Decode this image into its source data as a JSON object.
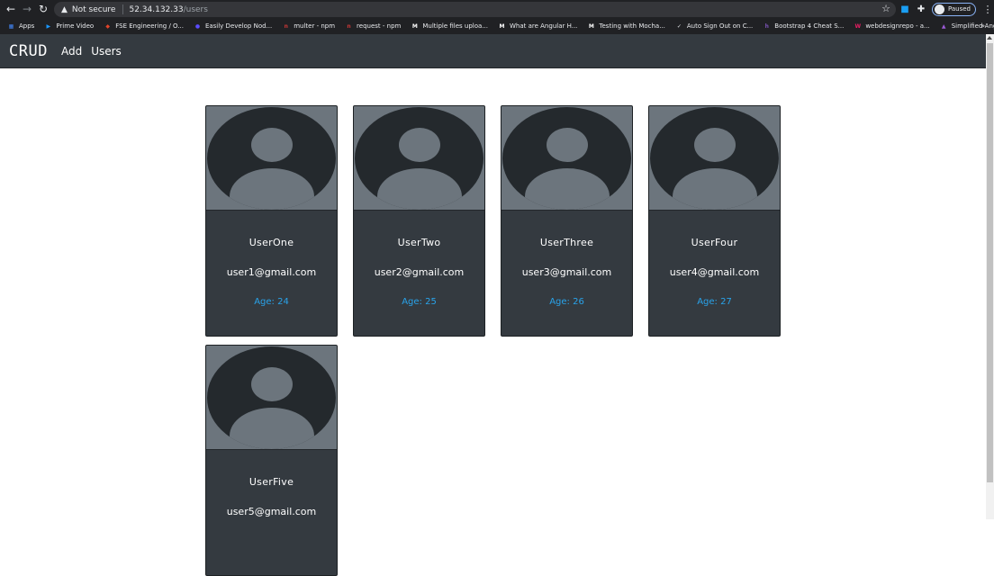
{
  "browser": {
    "security_label": "Not secure",
    "url_host": "52.34.132.33",
    "url_path": "/users",
    "profile_label": "Paused",
    "bookmarks": [
      {
        "label": "Apps",
        "color": "#4285f4",
        "glyph": "▦"
      },
      {
        "label": "Prime Video",
        "color": "#1a98ff",
        "glyph": "▶"
      },
      {
        "label": "FSE Engineering / O...",
        "color": "#e24329",
        "glyph": "◆"
      },
      {
        "label": "Easily Develop Nod...",
        "color": "#5b4cff",
        "glyph": "●"
      },
      {
        "label": "multer - npm",
        "color": "#cb3837",
        "glyph": "n"
      },
      {
        "label": "request - npm",
        "color": "#cb3837",
        "glyph": "n"
      },
      {
        "label": "Multiple files uploa...",
        "color": "#ffffff",
        "glyph": "M"
      },
      {
        "label": "What are Angular H...",
        "color": "#ffffff",
        "glyph": "M"
      },
      {
        "label": "Testing with Mocha...",
        "color": "#ffffff",
        "glyph": "M"
      },
      {
        "label": "Auto Sign Out on C...",
        "color": "#e8eaed",
        "glyph": "✓"
      },
      {
        "label": "Bootstrap 4 Cheat S...",
        "color": "#7952b3",
        "glyph": "h"
      },
      {
        "label": "webdesignrepo - a...",
        "color": "#e91e63",
        "glyph": "W"
      },
      {
        "label": "Simplified Angular...",
        "color": "#9c5bd6",
        "glyph": "▲"
      }
    ]
  },
  "navbar": {
    "brand": "CRUD",
    "links": [
      "Add",
      "Users"
    ]
  },
  "users": [
    {
      "name": "UserOne",
      "email": "user1@gmail.com",
      "age": "Age: 24"
    },
    {
      "name": "UserTwo",
      "email": "user2@gmail.com",
      "age": "Age: 25"
    },
    {
      "name": "UserThree",
      "email": "user3@gmail.com",
      "age": "Age: 26"
    },
    {
      "name": "UserFour",
      "email": "user4@gmail.com",
      "age": "Age: 27"
    },
    {
      "name": "UserFive",
      "email": "user5@gmail.com",
      "age": ""
    }
  ],
  "colors": {
    "navbar_bg": "#343a40",
    "card_bg": "#343a40",
    "avatar_bg": "#6c757d",
    "age_text": "#29a3ea"
  }
}
